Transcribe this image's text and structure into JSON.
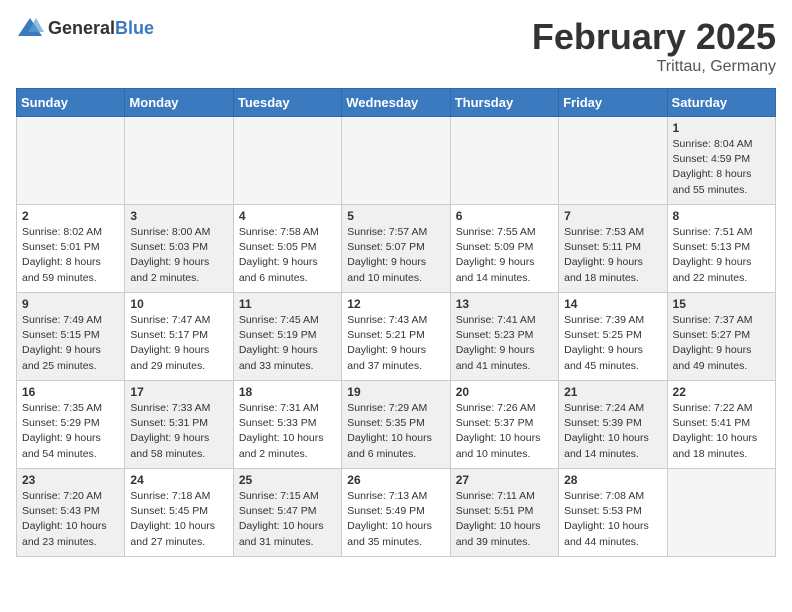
{
  "logo": {
    "general": "General",
    "blue": "Blue"
  },
  "header": {
    "month": "February 2025",
    "location": "Trittau, Germany"
  },
  "weekdays": [
    "Sunday",
    "Monday",
    "Tuesday",
    "Wednesday",
    "Thursday",
    "Friday",
    "Saturday"
  ],
  "weeks": [
    [
      {
        "day": "",
        "info": "",
        "empty": true
      },
      {
        "day": "",
        "info": "",
        "empty": true
      },
      {
        "day": "",
        "info": "",
        "empty": true
      },
      {
        "day": "",
        "info": "",
        "empty": true
      },
      {
        "day": "",
        "info": "",
        "empty": true
      },
      {
        "day": "",
        "info": "",
        "empty": true
      },
      {
        "day": "1",
        "info": "Sunrise: 8:04 AM\nSunset: 4:59 PM\nDaylight: 8 hours and 55 minutes.",
        "shaded": true
      }
    ],
    [
      {
        "day": "2",
        "info": "Sunrise: 8:02 AM\nSunset: 5:01 PM\nDaylight: 8 hours and 59 minutes.",
        "shaded": false
      },
      {
        "day": "3",
        "info": "Sunrise: 8:00 AM\nSunset: 5:03 PM\nDaylight: 9 hours and 2 minutes.",
        "shaded": true
      },
      {
        "day": "4",
        "info": "Sunrise: 7:58 AM\nSunset: 5:05 PM\nDaylight: 9 hours and 6 minutes.",
        "shaded": false
      },
      {
        "day": "5",
        "info": "Sunrise: 7:57 AM\nSunset: 5:07 PM\nDaylight: 9 hours and 10 minutes.",
        "shaded": true
      },
      {
        "day": "6",
        "info": "Sunrise: 7:55 AM\nSunset: 5:09 PM\nDaylight: 9 hours and 14 minutes.",
        "shaded": false
      },
      {
        "day": "7",
        "info": "Sunrise: 7:53 AM\nSunset: 5:11 PM\nDaylight: 9 hours and 18 minutes.",
        "shaded": true
      },
      {
        "day": "8",
        "info": "Sunrise: 7:51 AM\nSunset: 5:13 PM\nDaylight: 9 hours and 22 minutes.",
        "shaded": false
      }
    ],
    [
      {
        "day": "9",
        "info": "Sunrise: 7:49 AM\nSunset: 5:15 PM\nDaylight: 9 hours and 25 minutes.",
        "shaded": true
      },
      {
        "day": "10",
        "info": "Sunrise: 7:47 AM\nSunset: 5:17 PM\nDaylight: 9 hours and 29 minutes.",
        "shaded": false
      },
      {
        "day": "11",
        "info": "Sunrise: 7:45 AM\nSunset: 5:19 PM\nDaylight: 9 hours and 33 minutes.",
        "shaded": true
      },
      {
        "day": "12",
        "info": "Sunrise: 7:43 AM\nSunset: 5:21 PM\nDaylight: 9 hours and 37 minutes.",
        "shaded": false
      },
      {
        "day": "13",
        "info": "Sunrise: 7:41 AM\nSunset: 5:23 PM\nDaylight: 9 hours and 41 minutes.",
        "shaded": true
      },
      {
        "day": "14",
        "info": "Sunrise: 7:39 AM\nSunset: 5:25 PM\nDaylight: 9 hours and 45 minutes.",
        "shaded": false
      },
      {
        "day": "15",
        "info": "Sunrise: 7:37 AM\nSunset: 5:27 PM\nDaylight: 9 hours and 49 minutes.",
        "shaded": true
      }
    ],
    [
      {
        "day": "16",
        "info": "Sunrise: 7:35 AM\nSunset: 5:29 PM\nDaylight: 9 hours and 54 minutes.",
        "shaded": false
      },
      {
        "day": "17",
        "info": "Sunrise: 7:33 AM\nSunset: 5:31 PM\nDaylight: 9 hours and 58 minutes.",
        "shaded": true
      },
      {
        "day": "18",
        "info": "Sunrise: 7:31 AM\nSunset: 5:33 PM\nDaylight: 10 hours and 2 minutes.",
        "shaded": false
      },
      {
        "day": "19",
        "info": "Sunrise: 7:29 AM\nSunset: 5:35 PM\nDaylight: 10 hours and 6 minutes.",
        "shaded": true
      },
      {
        "day": "20",
        "info": "Sunrise: 7:26 AM\nSunset: 5:37 PM\nDaylight: 10 hours and 10 minutes.",
        "shaded": false
      },
      {
        "day": "21",
        "info": "Sunrise: 7:24 AM\nSunset: 5:39 PM\nDaylight: 10 hours and 14 minutes.",
        "shaded": true
      },
      {
        "day": "22",
        "info": "Sunrise: 7:22 AM\nSunset: 5:41 PM\nDaylight: 10 hours and 18 minutes.",
        "shaded": false
      }
    ],
    [
      {
        "day": "23",
        "info": "Sunrise: 7:20 AM\nSunset: 5:43 PM\nDaylight: 10 hours and 23 minutes.",
        "shaded": true
      },
      {
        "day": "24",
        "info": "Sunrise: 7:18 AM\nSunset: 5:45 PM\nDaylight: 10 hours and 27 minutes.",
        "shaded": false
      },
      {
        "day": "25",
        "info": "Sunrise: 7:15 AM\nSunset: 5:47 PM\nDaylight: 10 hours and 31 minutes.",
        "shaded": true
      },
      {
        "day": "26",
        "info": "Sunrise: 7:13 AM\nSunset: 5:49 PM\nDaylight: 10 hours and 35 minutes.",
        "shaded": false
      },
      {
        "day": "27",
        "info": "Sunrise: 7:11 AM\nSunset: 5:51 PM\nDaylight: 10 hours and 39 minutes.",
        "shaded": true
      },
      {
        "day": "28",
        "info": "Sunrise: 7:08 AM\nSunset: 5:53 PM\nDaylight: 10 hours and 44 minutes.",
        "shaded": false
      },
      {
        "day": "",
        "info": "",
        "empty": true
      }
    ]
  ]
}
